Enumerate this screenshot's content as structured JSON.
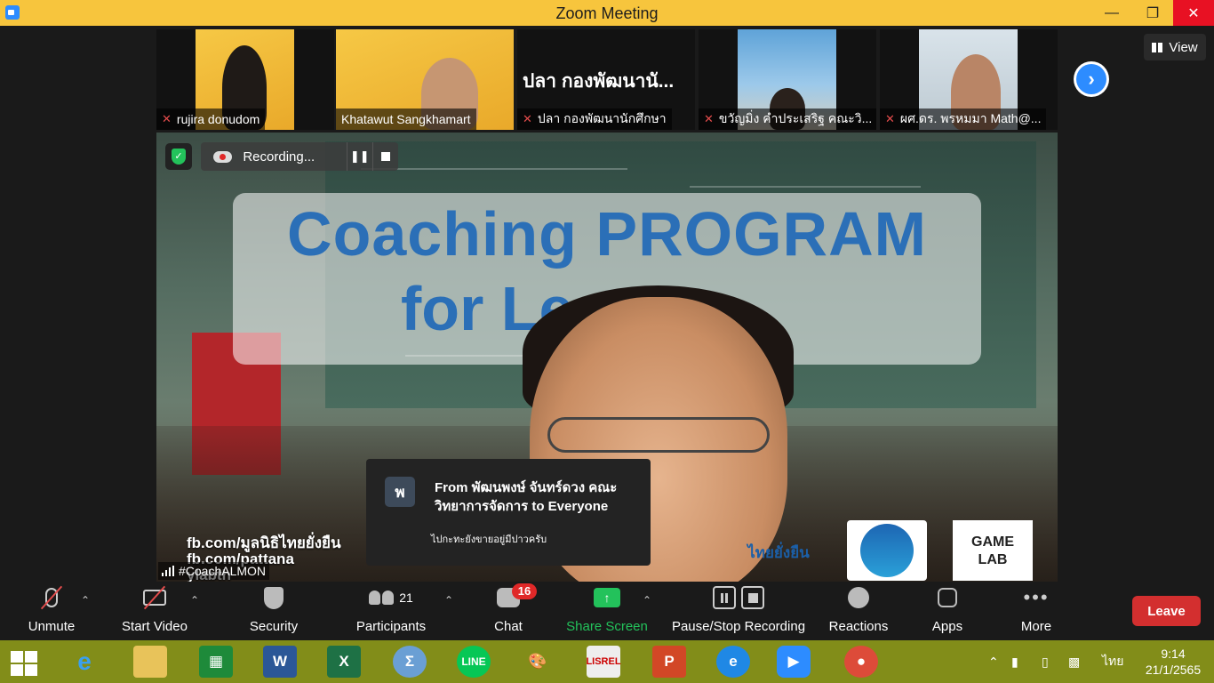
{
  "window": {
    "title": "Zoom Meeting"
  },
  "gallery": {
    "participants": [
      {
        "name": "rujira donudom",
        "muted": true
      },
      {
        "name": "Khatawut Sangkhamart",
        "muted": false
      },
      {
        "name": "ปลา กองพัฒนานักศึกษา",
        "muted": true,
        "video_label": "ปลา กองพัฒนานั..."
      },
      {
        "name": "ขวัญมิ่ง คำประเสริฐ คณะวิ...",
        "muted": true
      },
      {
        "name": "ผศ.ดร. พรหมมา Math@...",
        "muted": true
      }
    ],
    "view_label": "View"
  },
  "main_video": {
    "slide_title_line1": "Coaching PROGRAM",
    "slide_title_line2": "for Learner",
    "fb_lines": [
      "fb.com/มูลนิธิไทยยั่งยืน",
      "fb.com/pattana",
      "ylabth"
    ],
    "logo_thai": "ไทยยั่งยืน",
    "logo_game_1": "GAME",
    "logo_game_2": "LAB",
    "self_name": "#CoachALMON",
    "recording_label": "Recording..."
  },
  "chat_toast": {
    "avatar_letter": "พ",
    "from": "From พัฒนพงษ์ จันทร์ดวง คณะวิทยาการจัดการ to Everyone",
    "message": "ไปกะทะยังขายอยู่มีปาวครับ"
  },
  "toolbar": {
    "unmute": "Unmute",
    "start_video": "Start Video",
    "security": "Security",
    "participants": "Participants",
    "participants_count": "21",
    "chat": "Chat",
    "chat_badge": "16",
    "share_screen": "Share Screen",
    "pause_stop_recording": "Pause/Stop Recording",
    "reactions": "Reactions",
    "apps": "Apps",
    "more": "More",
    "leave": "Leave"
  },
  "taskbar": {
    "language": "ไทย",
    "time": "9:14",
    "date": "21/1/2565"
  },
  "colors": {
    "title_bar": "#f7c53d",
    "zoom_blue": "#2d8cff",
    "share_green": "#23c25b",
    "leave_red": "#d32f2f",
    "taskbar": "#828d19"
  }
}
